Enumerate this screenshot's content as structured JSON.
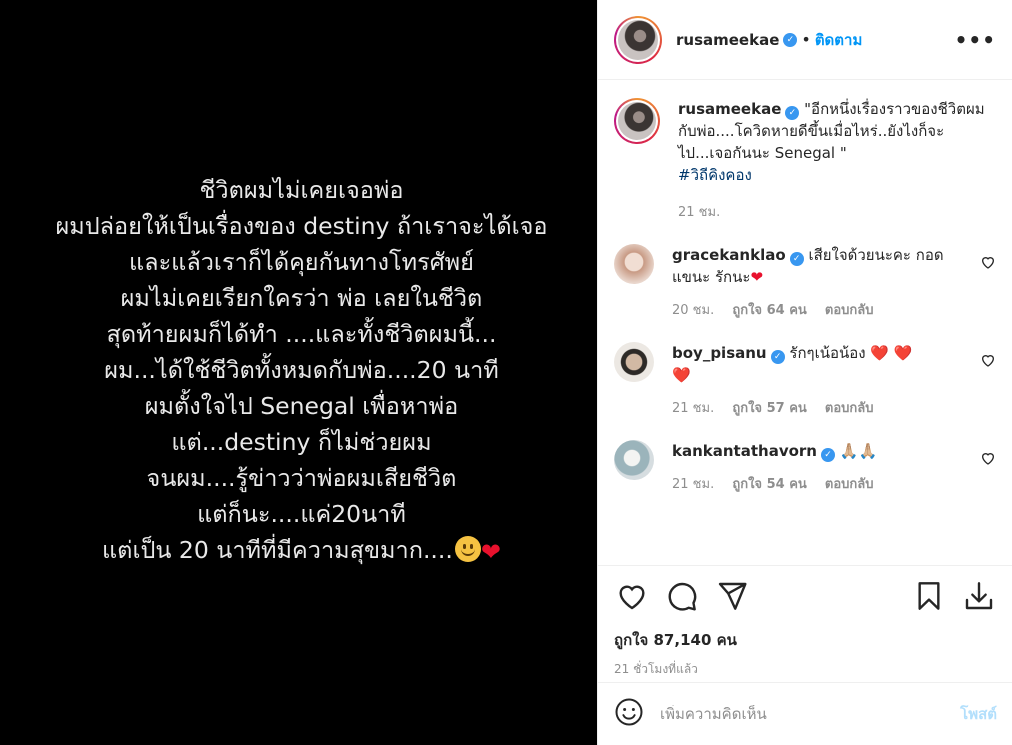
{
  "media": {
    "lines": [
      "ชีวิตผมไม่เคยเจอพ่อ",
      "ผมปล่อยให้เป็นเรื่องของ destiny  ถ้าเราจะได้เจอ",
      "และแล้วเราก็ได้คุยกันทางโทรศัพย์",
      "ผมไม่เคยเรียกใครว่า พ่อ เลยในชีวิต",
      "สุดท้ายผมก็ได้ทำ ....และทั้งชีวิตผมนี้...",
      "ผม...ได้ใช้ชีวิตทั้งหมดกับพ่อ....20 นาที",
      "ผมตั้งใจไป Senegal เพื่อหาพ่อ",
      "แต่...destiny ก็ไม่ช่วยผม",
      "จนผม....รู้ข่าวว่าพ่อผมเสียชีวิต",
      "แต่ก็นะ....แค่20นาที",
      "แต่เป็น 20 นาทีที่มีความสุขมาก...."
    ],
    "last_emojis": [
      "smile-emoji",
      "red-heart-emoji"
    ]
  },
  "header": {
    "username": "rusameekae",
    "dot": "•",
    "follow_label": "ติดตาม",
    "more_label": "•••"
  },
  "caption": {
    "username": "rusameekae",
    "text": "\"อีกหนึ่งเรื่องราวของชีวิตผมกับพ่อ....โควิดหายดีขึ้นเมื่อไหร่..ยังไงก็จะไป...เจอกันนะ Senegal \"",
    "hashtag": "#วิถีคิงคอง",
    "time": "21 ชม."
  },
  "comments": [
    {
      "username": "gracekanklao",
      "text": "เสียใจด้วยนะคะ กอดแขนะ รักนะ",
      "time": "20 ชม.",
      "likes": "ถูกใจ 64 คน",
      "reply": "ตอบกลับ",
      "avatar_color": "#d8b7a6"
    },
    {
      "username": "boy_pisanu",
      "text": "รักๆเน้อน้อง",
      "time": "21 ชม.",
      "likes": "ถูกใจ 57 คน",
      "reply": "ตอบกลับ",
      "avatar_color": "#c9c4bd"
    },
    {
      "username": "kankantathavorn",
      "text": "🙏🏼🙏🏼",
      "time": "21 ชม.",
      "likes": "ถูกใจ 54 คน",
      "reply": "ตอบกลับ",
      "avatar_color": "#a7bcc4"
    }
  ],
  "actions": {
    "likes": "ถูกใจ 87,140 คน",
    "time_ago": "21 ชั่วโมงที่แล้ว"
  },
  "add_comment": {
    "placeholder": "เพิ่มความคิดเห็น",
    "post_label": "โพสต์"
  },
  "colors": {
    "accent": "#0095f6",
    "verified": "#3897f0",
    "heart": "#e8112d"
  }
}
